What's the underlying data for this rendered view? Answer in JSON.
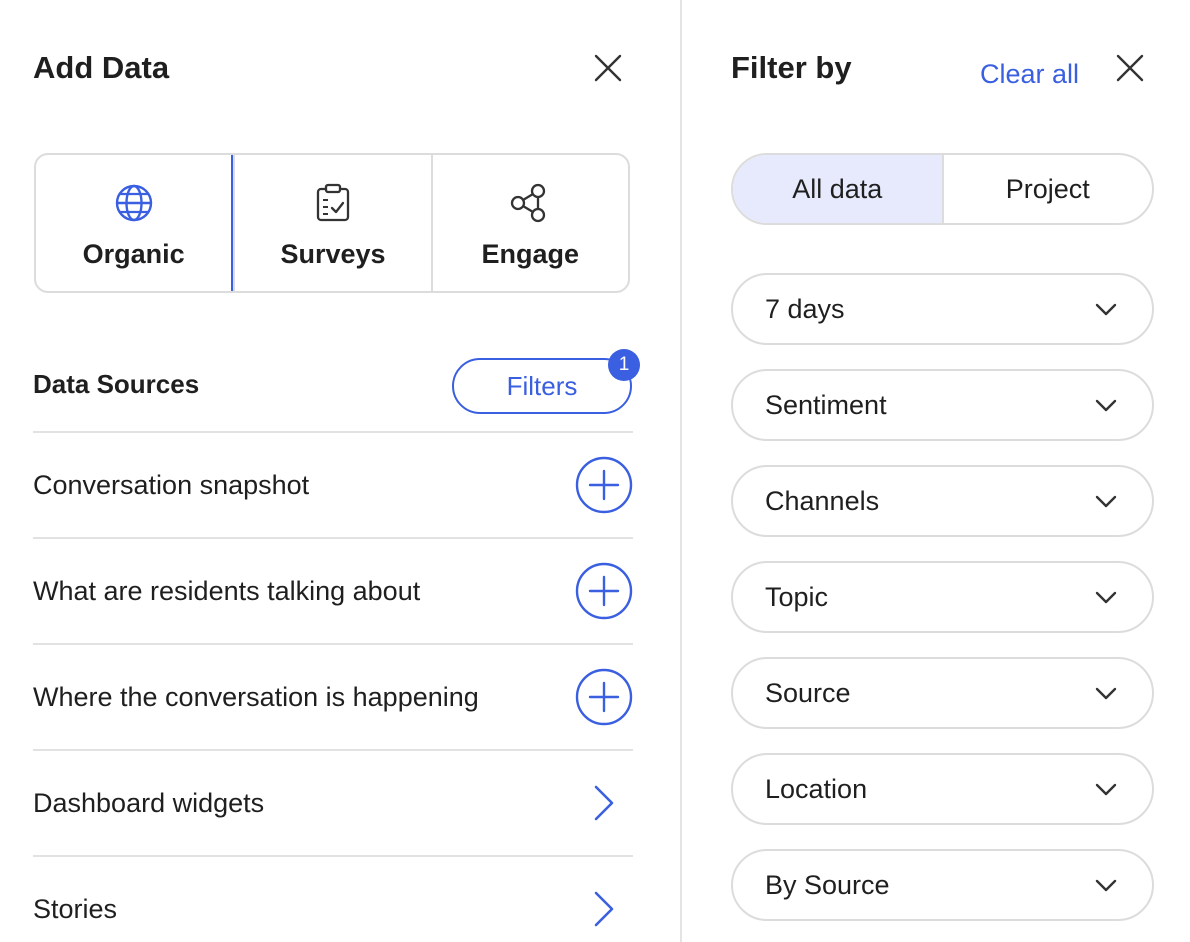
{
  "add_data": {
    "title": "Add Data",
    "tabs": [
      {
        "label": "Organic",
        "icon": "globe-icon",
        "active": true
      },
      {
        "label": "Surveys",
        "icon": "clipboard-check-icon",
        "active": false
      },
      {
        "label": "Engage",
        "icon": "network-nodes-icon",
        "active": false
      }
    ],
    "data_sources": {
      "title": "Data Sources",
      "filters_label": "Filters",
      "filters_count": "1",
      "items": [
        {
          "label": "Conversation snapshot",
          "action": "plus-circle-icon"
        },
        {
          "label": "What are residents talking about",
          "action": "plus-circle-icon"
        },
        {
          "label": "Where the conversation is happening",
          "action": "plus-circle-icon"
        },
        {
          "label": "Dashboard widgets",
          "action": "chevron-right-icon"
        },
        {
          "label": "Stories",
          "action": "chevron-right-icon"
        }
      ]
    }
  },
  "filter_by": {
    "title": "Filter by",
    "clear_all": "Clear all",
    "scope": {
      "options": [
        "All data",
        "Project"
      ],
      "selected": "All data"
    },
    "dropdowns": [
      "7 days",
      "Sentiment",
      "Channels",
      "Topic",
      "Source",
      "Location",
      "By Source"
    ]
  },
  "colors": {
    "accent": "#3a5fe0",
    "selected_bg": "#e7eafc",
    "border": "#dcdcdc",
    "text": "#1f1f1f"
  }
}
